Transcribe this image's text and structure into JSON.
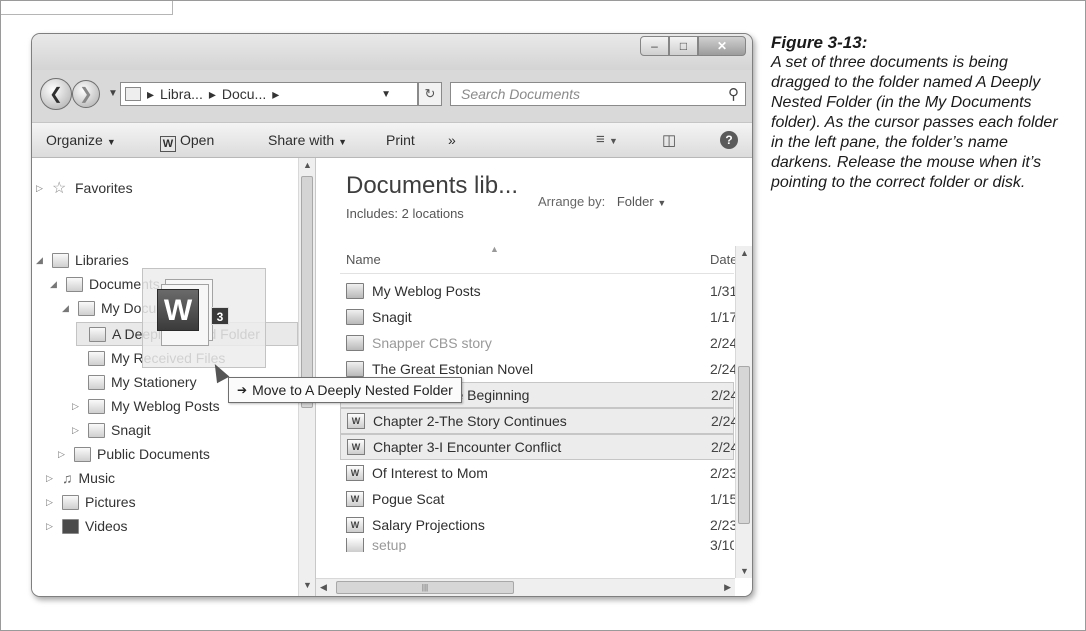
{
  "window": {
    "breadcrumb": [
      "Libra...",
      "Docu..."
    ],
    "search_placeholder": "Search Documents"
  },
  "toolbar": {
    "organize": "Organize",
    "open": "Open",
    "share_with": "Share with",
    "print": "Print",
    "more": "»"
  },
  "nav": {
    "favorites": "Favorites",
    "libraries": "Libraries",
    "documents": "Documents",
    "my_documents": "My Documents",
    "deeply_nested": "A Deeply Nested Folder",
    "my_received": "My Received Files",
    "my_stationery": "My Stationery",
    "my_weblog": "My Weblog Posts",
    "snagit": "Snagit",
    "public_documents": "Public Documents",
    "music": "Music",
    "pictures": "Pictures",
    "videos": "Videos"
  },
  "drag": {
    "count": "3",
    "tooltip": "Move to A Deeply Nested Folder"
  },
  "content": {
    "title": "Documents lib...",
    "includes": "Includes: 2 locations",
    "arrange_by_label": "Arrange by:",
    "arrange_by_value": "Folder",
    "columns": {
      "name": "Name",
      "date": "Date"
    },
    "files": [
      {
        "name": "My Weblog Posts",
        "date": "1/31",
        "kind": "folder"
      },
      {
        "name": "Snagit",
        "date": "1/17",
        "kind": "folder"
      },
      {
        "name": "Snapper CBS story",
        "date": "2/24",
        "kind": "folder"
      },
      {
        "name": "The Great Estonian Novel",
        "date": "2/24",
        "kind": "folder"
      },
      {
        "name": "Chapter 1-The Beginning",
        "date": "2/24",
        "kind": "doc"
      },
      {
        "name": "Chapter 2-The Story Continues",
        "date": "2/24",
        "kind": "doc"
      },
      {
        "name": "Chapter 3-I Encounter Conflict",
        "date": "2/24",
        "kind": "doc"
      },
      {
        "name": "Of Interest to Mom",
        "date": "2/23",
        "kind": "doc"
      },
      {
        "name": "Pogue Scat",
        "date": "1/15",
        "kind": "doc"
      },
      {
        "name": "Salary Projections",
        "date": "2/23",
        "kind": "doc"
      },
      {
        "name": "setup",
        "date": "3/10",
        "kind": "doc"
      }
    ]
  },
  "caption": {
    "figure": "Figure 3-13:",
    "text": "A set of three documents is being dragged to the folder named A Deeply Nested Folder (in the My Documents folder). As the cursor passes each folder in the left pane, the folder’s name darkens. Release the mouse when it’s pointing to the correct folder or disk."
  }
}
